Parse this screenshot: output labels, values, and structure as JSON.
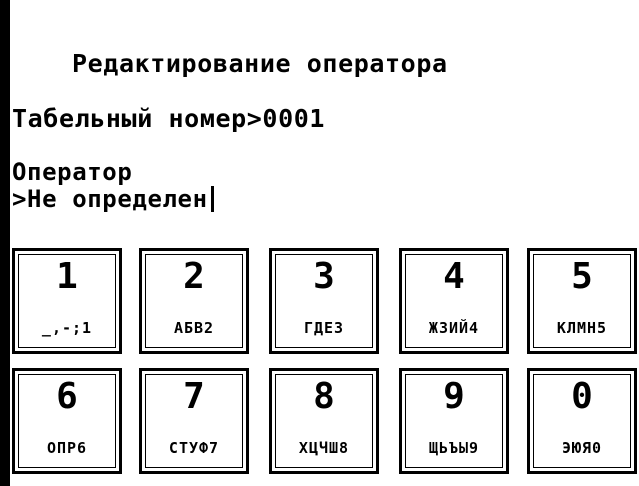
{
  "screen": {
    "title": "Редактирование оператора",
    "tab_number_line": "Табельный номер>0001",
    "operator_label": "Оператор",
    "operator_value": ">Не определен"
  },
  "keypad": {
    "keys": [
      {
        "digit": "1",
        "letters": "_,-;1"
      },
      {
        "digit": "2",
        "letters": "АБВ2"
      },
      {
        "digit": "3",
        "letters": "ГДЕ3"
      },
      {
        "digit": "4",
        "letters": "ЖЗИЙ4"
      },
      {
        "digit": "5",
        "letters": "КЛМН5"
      },
      {
        "digit": "6",
        "letters": "ОПР6"
      },
      {
        "digit": "7",
        "letters": "СТУФ7"
      },
      {
        "digit": "8",
        "letters": "ХЦЧШ8"
      },
      {
        "digit": "9",
        "letters": "ЩЬЪЫ9"
      },
      {
        "digit": "0",
        "letters": "ЭЮЯ0"
      }
    ]
  }
}
